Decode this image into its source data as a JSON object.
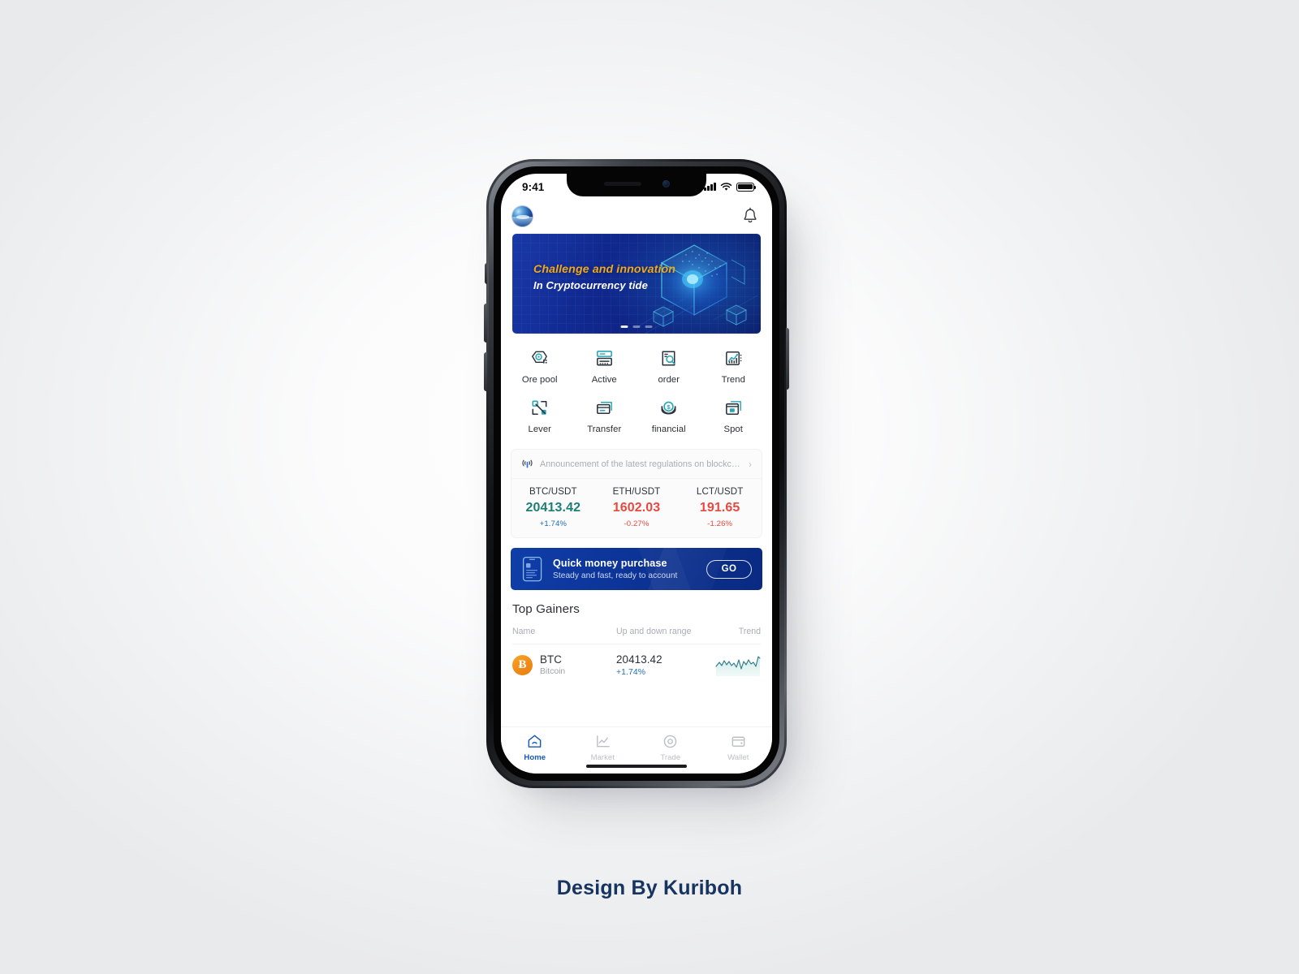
{
  "status_bar": {
    "time": "9:41",
    "signal_icon": "cellular-signal-icon",
    "wifi_icon": "wifi-icon",
    "battery_icon": "battery-icon"
  },
  "header": {
    "avatar_icon": "user-avatar",
    "notification_icon": "bell-icon"
  },
  "banner": {
    "headline": "Challenge and innovation",
    "subline": "In Cryptocurrency tide",
    "art_icon": "isometric-cube-blockchain-graphic",
    "dots": [
      "active",
      "inactive",
      "inactive"
    ]
  },
  "shortcuts": [
    {
      "label": "Ore pool",
      "icon": "ore-pool-icon"
    },
    {
      "label": "Active",
      "icon": "active-icon"
    },
    {
      "label": "order",
      "icon": "order-search-icon"
    },
    {
      "label": "Trend",
      "icon": "trend-chart-icon"
    },
    {
      "label": "Lever",
      "icon": "lever-expand-icon"
    },
    {
      "label": "Transfer",
      "icon": "transfer-card-icon"
    },
    {
      "label": "financial",
      "icon": "financial-dollar-icon"
    },
    {
      "label": "Spot",
      "icon": "spot-window-icon"
    }
  ],
  "announcement": {
    "icon": "broadcast-icon",
    "text": "Announcement of the latest regulations on blockch...",
    "chevron": "chevron-right-icon"
  },
  "tickers": [
    {
      "pair": "BTC/USDT",
      "price": "20413.42",
      "change": "+1.74%",
      "direction": "up"
    },
    {
      "pair": "ETH/USDT",
      "price": "1602.03",
      "change": "-0.27%",
      "direction": "down"
    },
    {
      "pair": "LCT/USDT",
      "price": "191.65",
      "change": "-1.26%",
      "direction": "down"
    }
  ],
  "quick_purchase": {
    "icon": "phone-purchase-icon",
    "title": "Quick money purchase",
    "subtitle": "Steady and fast, ready to account",
    "cta": "GO"
  },
  "top_gainers": {
    "title": "Top Gainers",
    "columns": {
      "name": "Name",
      "range": "Up and down range",
      "trend": "Trend"
    },
    "rows": [
      {
        "symbol": "BTC",
        "full_name": "Bitcoin",
        "coin_icon": "bitcoin-icon",
        "coin_glyph": "Ƀ",
        "price": "20413.42",
        "change": "+1.74%",
        "direction": "up",
        "sparkline_icon": "sparkline-chart"
      }
    ]
  },
  "tabbar": [
    {
      "label": "Home",
      "icon": "home-icon",
      "active": true
    },
    {
      "label": "Market",
      "icon": "market-icon",
      "active": false
    },
    {
      "label": "Trade",
      "icon": "trade-icon",
      "active": false
    },
    {
      "label": "Wallet",
      "icon": "wallet-icon",
      "active": false
    }
  ],
  "credit": "Design By Kuriboh",
  "colors": {
    "brand_blue": "#0d3599",
    "accent_teal": "#2aa6b8",
    "up_green": "#1d7f74",
    "down_red": "#e8483f",
    "gold": "#f0a81d",
    "bitcoin_orange": "#f08b18"
  }
}
